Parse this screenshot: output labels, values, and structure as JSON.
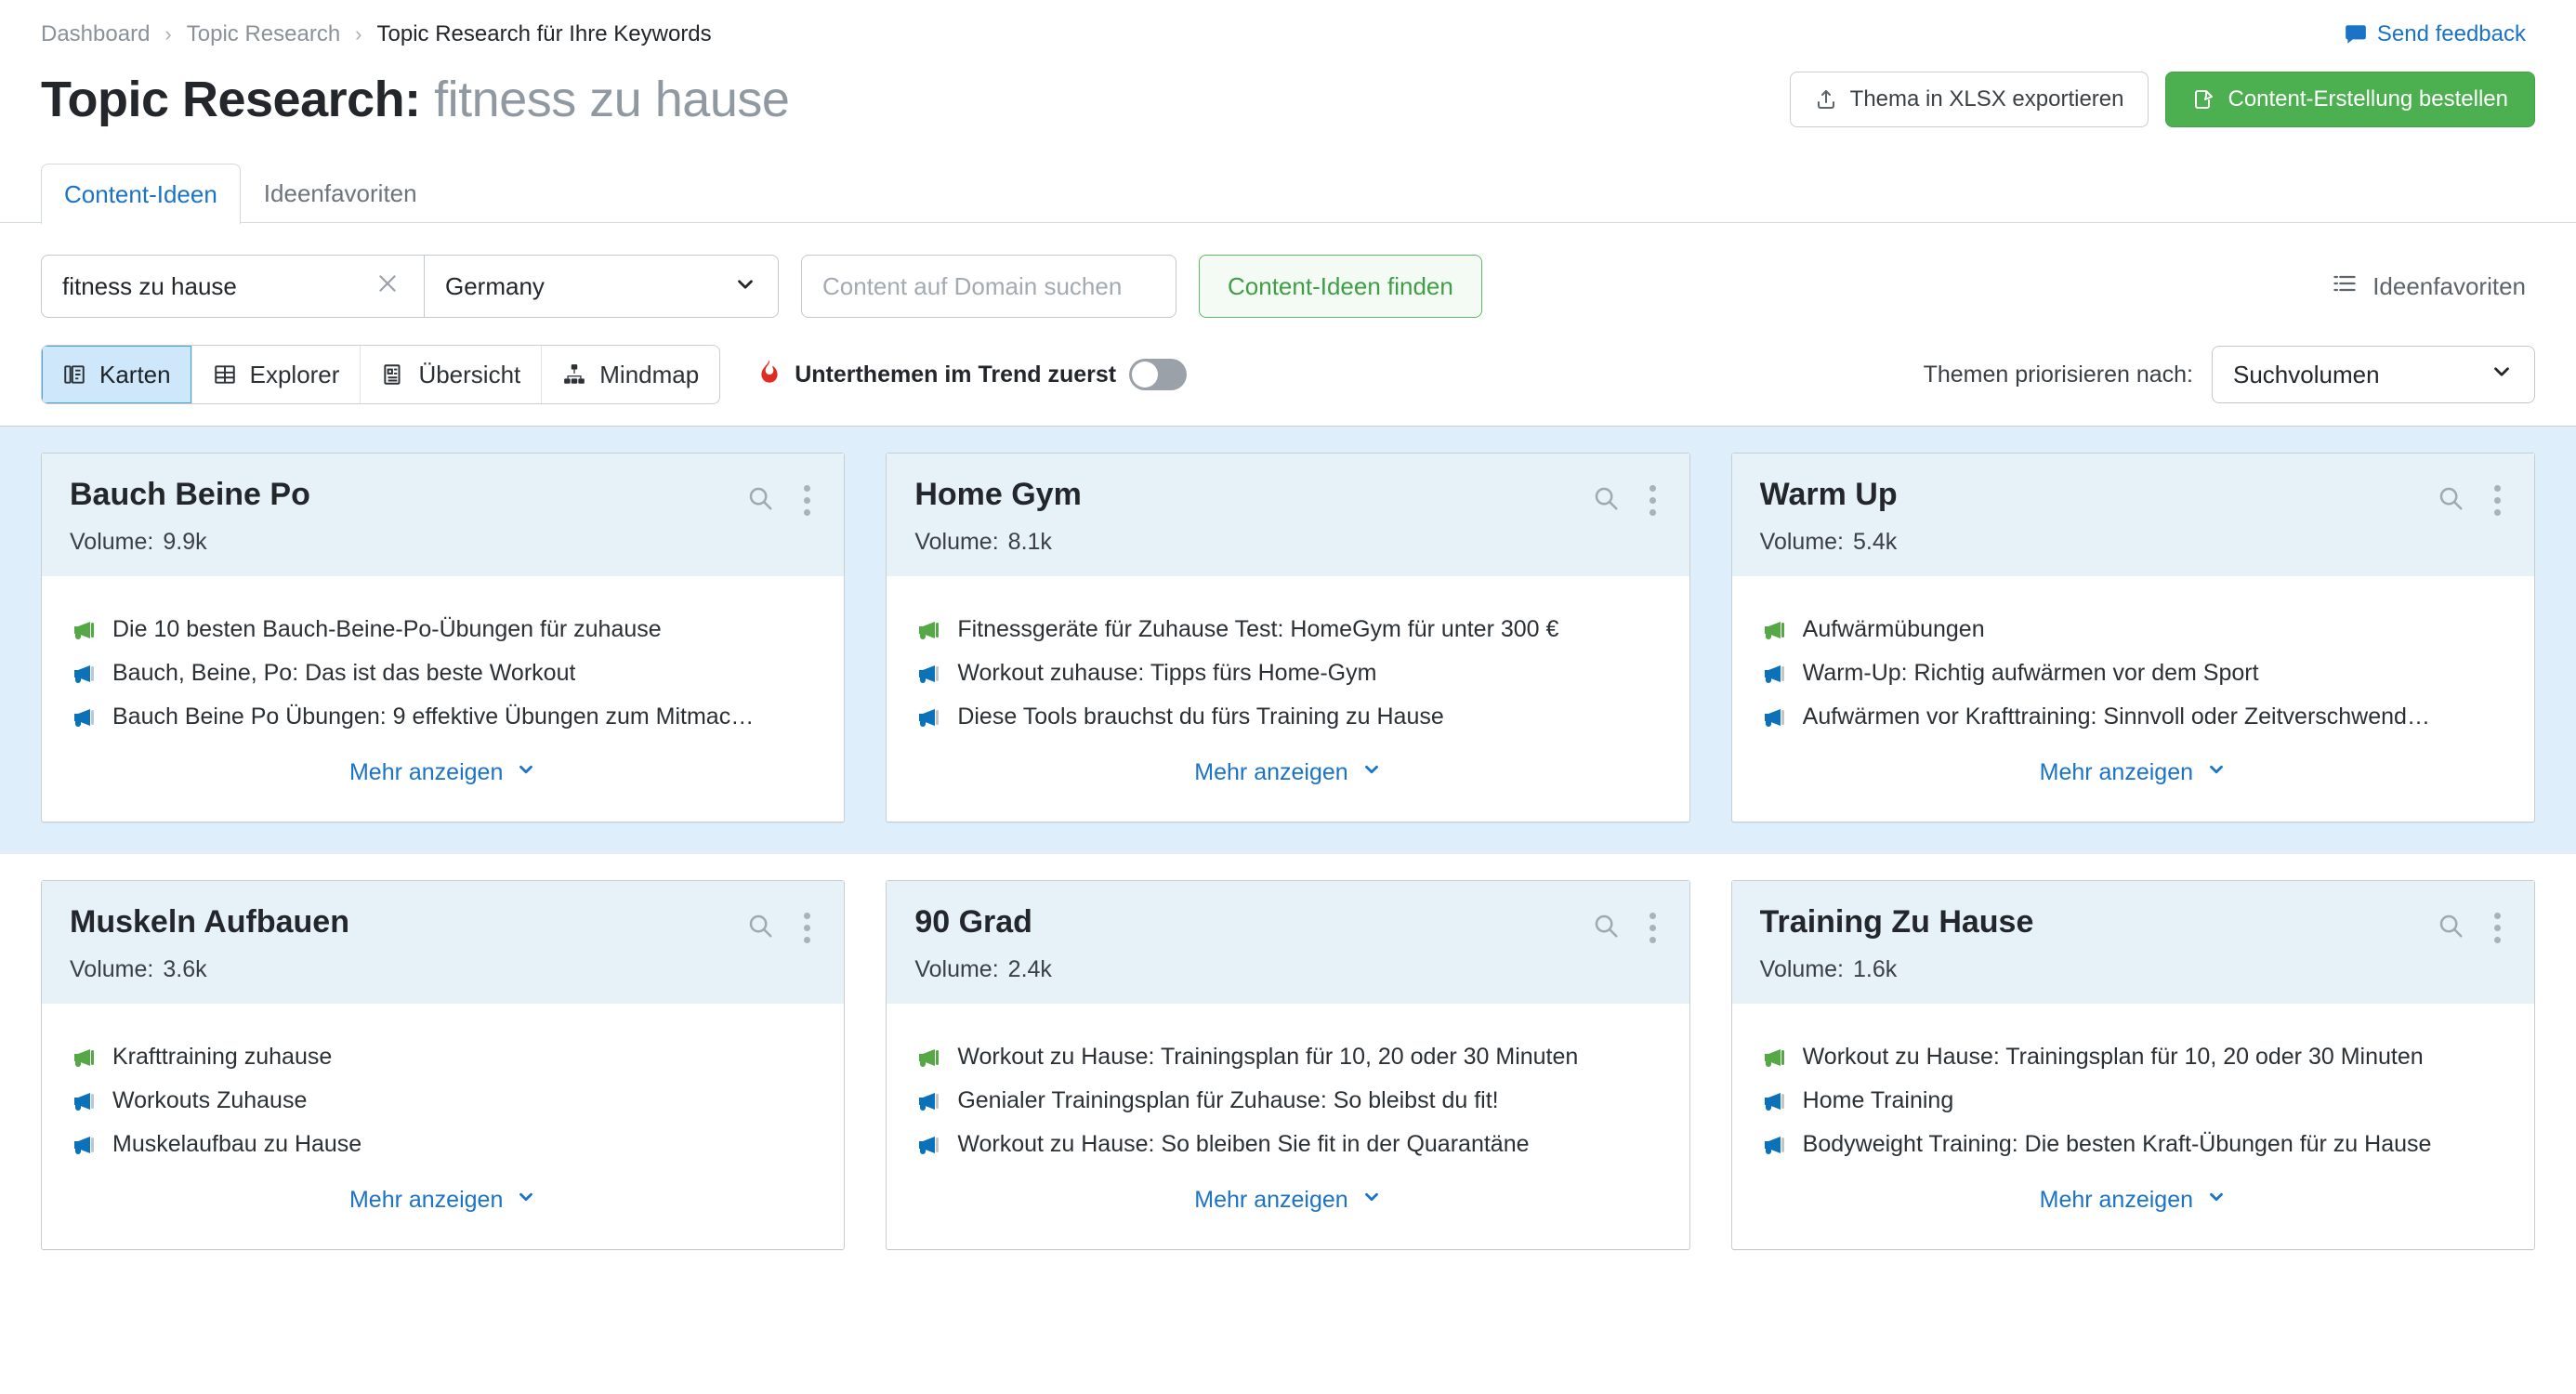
{
  "breadcrumb": {
    "items": [
      "Dashboard",
      "Topic Research",
      "Topic Research für Ihre Keywords"
    ],
    "separator": "›"
  },
  "feedback": {
    "label": "Send feedback",
    "icon": "speech-bubble-icon",
    "color": "#1a73c7"
  },
  "header": {
    "title_prefix": "Topic Research:",
    "title_keyword": "fitness zu hause",
    "export_button": "Thema in XLSX exportieren",
    "order_button": "Content-Erstellung bestellen",
    "order_button_color": "#4caf50"
  },
  "tabs": [
    {
      "label": "Content-Ideen",
      "active": true
    },
    {
      "label": "Ideenfavoriten",
      "active": false
    }
  ],
  "search": {
    "keyword_value": "fitness zu hause",
    "clear_icon": "close-icon",
    "database_value": "Germany",
    "domain_placeholder": "Content auf Domain suchen",
    "domain_value": "",
    "find_button": "Content-Ideen finden",
    "favorites_link": "Ideenfavoriten"
  },
  "view_modes": [
    {
      "label": "Karten",
      "icon": "cards-icon",
      "active": true
    },
    {
      "label": "Explorer",
      "icon": "grid-icon",
      "active": false
    },
    {
      "label": "Übersicht",
      "icon": "overview-icon",
      "active": false
    },
    {
      "label": "Mindmap",
      "icon": "mindmap-icon",
      "active": false
    }
  ],
  "trend_toggle": {
    "label": "Unterthemen im Trend zuerst",
    "icon": "flame-icon",
    "icon_color": "#e02b20",
    "enabled": false
  },
  "prioritize": {
    "label": "Themen priorisieren nach:",
    "value": "Suchvolumen"
  },
  "card_labels": {
    "volume_label": "Volume:",
    "more_label": "Mehr anzeigen",
    "search_icon": "magnifier-icon",
    "menu_icon": "kebab-menu-icon",
    "chevron_icon": "chevron-down-icon"
  },
  "rows": [
    {
      "highlighted": true,
      "cards": [
        {
          "title": "Bauch Beine Po",
          "volume": "9.9k",
          "ideas": [
            {
              "text": "Die 10 besten Bauch-Beine-Po-Übungen für zuhause",
              "icon": "megaphone-green-icon",
              "color": "#56a746"
            },
            {
              "text": "Bauch, Beine, Po: Das ist das beste Workout",
              "icon": "megaphone-blue-icon",
              "color": "#0b72ba"
            },
            {
              "text": "Bauch Beine Po Übungen: 9 effektive Übungen zum Mitmac…",
              "icon": "megaphone-blue-icon",
              "color": "#0b72ba"
            }
          ]
        },
        {
          "title": "Home Gym",
          "volume": "8.1k",
          "ideas": [
            {
              "text": "Fitnessgeräte für Zuhause Test: HomeGym für unter 300 €",
              "icon": "megaphone-green-icon",
              "color": "#56a746"
            },
            {
              "text": "Workout zuhause: Tipps fürs Home-Gym",
              "icon": "megaphone-blue-icon",
              "color": "#0b72ba"
            },
            {
              "text": "Diese Tools brauchst du fürs Training zu Hause",
              "icon": "megaphone-blue-icon",
              "color": "#0b72ba"
            }
          ]
        },
        {
          "title": "Warm Up",
          "volume": "5.4k",
          "ideas": [
            {
              "text": "Aufwärmübungen",
              "icon": "megaphone-green-icon",
              "color": "#56a746"
            },
            {
              "text": "Warm-Up: Richtig aufwärmen vor dem Sport",
              "icon": "megaphone-blue-icon",
              "color": "#0b72ba"
            },
            {
              "text": "Aufwärmen vor Krafttraining: Sinnvoll oder Zeitverschwend…",
              "icon": "megaphone-blue-icon",
              "color": "#0b72ba"
            }
          ]
        }
      ]
    },
    {
      "highlighted": false,
      "cards": [
        {
          "title": "Muskeln Aufbauen",
          "volume": "3.6k",
          "ideas": [
            {
              "text": "Krafttraining zuhause",
              "icon": "megaphone-green-icon",
              "color": "#56a746"
            },
            {
              "text": "Workouts Zuhause",
              "icon": "megaphone-blue-icon",
              "color": "#0b72ba"
            },
            {
              "text": "Muskelaufbau zu Hause",
              "icon": "megaphone-blue-icon",
              "color": "#0b72ba"
            }
          ]
        },
        {
          "title": "90 Grad",
          "volume": "2.4k",
          "ideas": [
            {
              "text": "Workout zu Hause: Trainingsplan für 10, 20 oder 30 Minuten",
              "icon": "megaphone-green-icon",
              "color": "#56a746"
            },
            {
              "text": "Genialer Trainingsplan für Zuhause: So bleibst du fit!",
              "icon": "megaphone-blue-icon",
              "color": "#0b72ba"
            },
            {
              "text": "Workout zu Hause: So bleiben Sie fit in der Quarantäne",
              "icon": "megaphone-blue-icon",
              "color": "#0b72ba"
            }
          ]
        },
        {
          "title": "Training Zu Hause",
          "volume": "1.6k",
          "ideas": [
            {
              "text": "Workout zu Hause: Trainingsplan für 10, 20 oder 30 Minuten",
              "icon": "megaphone-green-icon",
              "color": "#56a746"
            },
            {
              "text": "Home Training",
              "icon": "megaphone-blue-icon",
              "color": "#0b72ba"
            },
            {
              "text": "Bodyweight Training: Die besten Kraft-Übungen für zu Hause",
              "icon": "megaphone-blue-icon",
              "color": "#0b72ba"
            }
          ]
        }
      ]
    }
  ]
}
